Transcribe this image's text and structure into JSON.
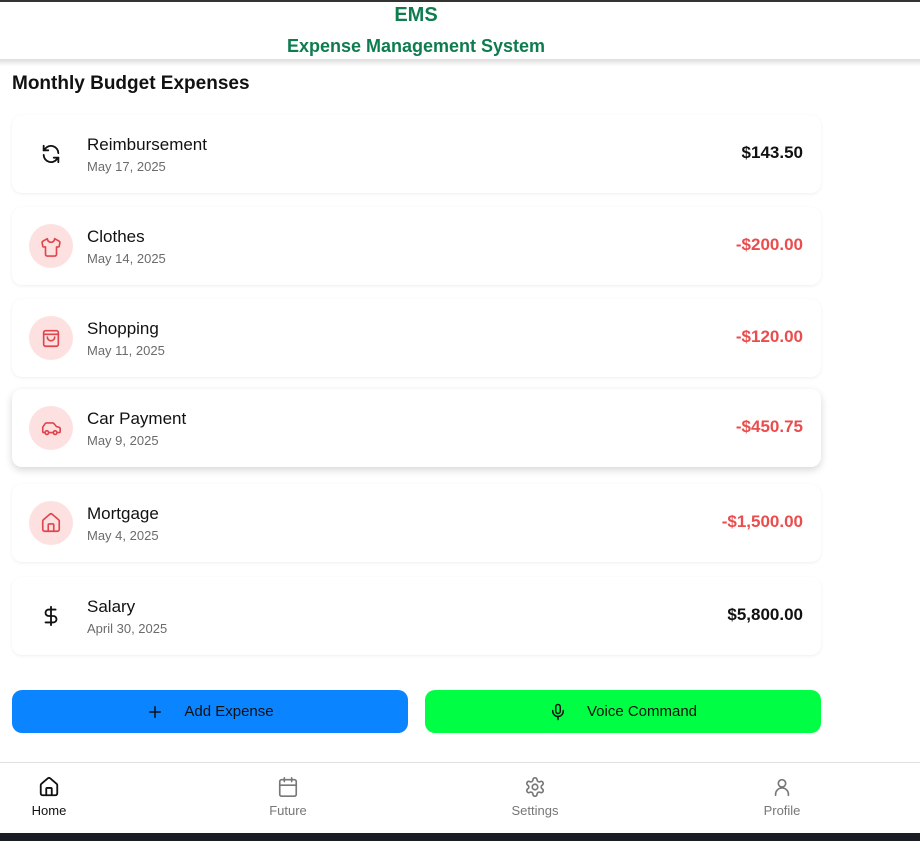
{
  "header": {
    "title": "EMS",
    "subtitle": "Expense Management System",
    "color": "#0e7c4f"
  },
  "section": {
    "title": "Monthly Budget Expenses"
  },
  "transactions": [
    {
      "name": "Reimbursement",
      "date": "May 17, 2025",
      "amount": "$143.50",
      "icon": "refresh-icon",
      "type": "income"
    },
    {
      "name": "Clothes",
      "date": "May 14, 2025",
      "amount": "-$200.00",
      "icon": "shirt-icon",
      "type": "expense"
    },
    {
      "name": "Shopping",
      "date": "May 11, 2025",
      "amount": "-$120.00",
      "icon": "shopping-bag-icon",
      "type": "expense"
    },
    {
      "name": "Car Payment",
      "date": "May 9, 2025",
      "amount": "-$450.75",
      "icon": "car-icon",
      "type": "expense"
    },
    {
      "name": "Mortgage",
      "date": "May 4, 2025",
      "amount": "-$1,500.00",
      "icon": "home-icon",
      "type": "expense"
    },
    {
      "name": "Salary",
      "date": "April 30, 2025",
      "amount": "$5,800.00",
      "icon": "dollar-icon",
      "type": "income"
    }
  ],
  "actions": {
    "add_label": "Add Expense",
    "add_icon": "plus-icon",
    "add_color": "#0a84ff",
    "voice_label": "Voice Command",
    "voice_icon": "microphone-icon",
    "voice_color": "#00ff44"
  },
  "nav": {
    "items": [
      {
        "label": "Home",
        "icon": "home-icon",
        "active": true
      },
      {
        "label": "Future",
        "icon": "calendar-icon",
        "active": false
      },
      {
        "label": "Settings",
        "icon": "gear-icon",
        "active": false
      },
      {
        "label": "Profile",
        "icon": "user-icon",
        "active": false
      }
    ]
  },
  "colors": {
    "expense_text": "#ea4d4d",
    "expense_icon_bg": "#fde1e1",
    "expense_icon": "#e0454d"
  }
}
